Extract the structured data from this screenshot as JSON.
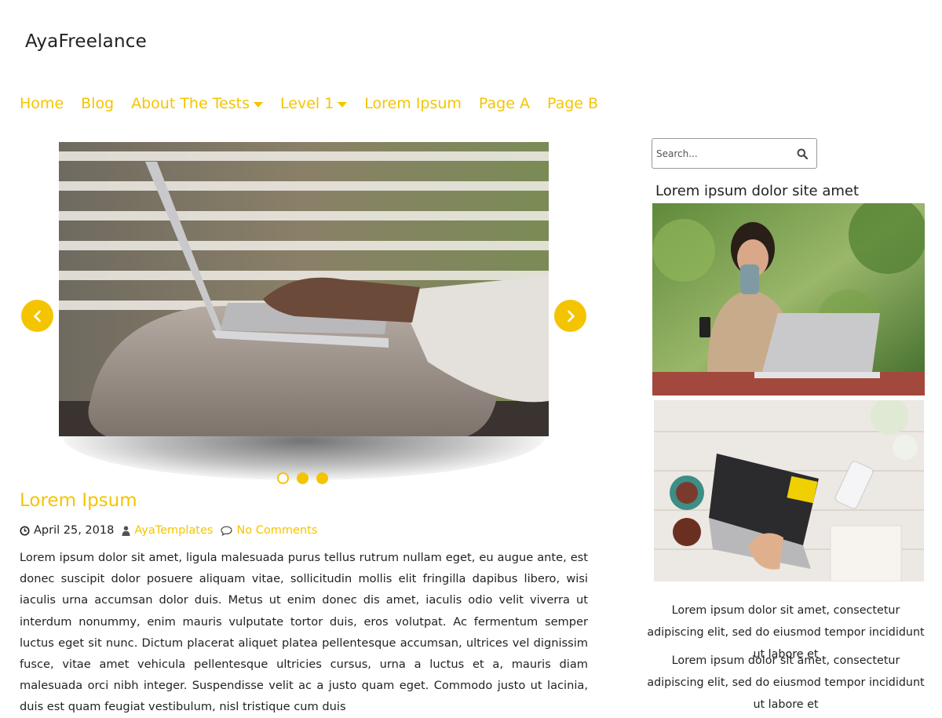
{
  "site": {
    "title": "AyaFreelance"
  },
  "nav": {
    "items": [
      {
        "label": "Home"
      },
      {
        "label": "Blog"
      },
      {
        "label": "About The Tests"
      },
      {
        "label": "Level 1"
      },
      {
        "label": "Lorem Ipsum"
      },
      {
        "label": "Page A"
      },
      {
        "label": "Page B"
      }
    ]
  },
  "slider": {
    "slides_count": 3,
    "active_index": 0
  },
  "post": {
    "title": "Lorem Ipsum",
    "date": "April 25, 2018",
    "author": "AyaTemplates",
    "comments": "No Comments",
    "excerpt": "Lorem ipsum dolor sit amet, ligula malesuada purus tellus rutrum nullam eget, eu augue ante, est donec suscipit dolor posuere aliquam vitae, sollicitudin mollis elit fringilla dapibus libero, wisi iaculis urna accumsan dolor duis. Metus ut enim donec dis amet, iaculis odio velit viverra ut interdum nonummy, enim mauris vulputate tortor duis, eros volutpat. Ac fermentum semper luctus eget sit nunc. Dictum placerat aliquet platea pellentesque accumsan, ultrices vel dignissim fusce, vitae amet vehicula pellentesque ultricies cursus, urna a luctus et a, mauris diam malesuada orci nibh integer. Suspendisse velit ac a justo quam eget. Commodo justo ut lacinia, duis est quam feugiat vestibulum, nisl tristique cum duis"
  },
  "sidebar": {
    "search_placeholder": "Search...",
    "widget_title": "Lorem ipsum dolor site amet",
    "paragraph1": "Lorem ipsum dolor sit amet, consectetur adipiscing elit, sed do eiusmod tempor incididunt ut labore et",
    "paragraph2": "Lorem ipsum dolor sit amet, consectetur adipiscing elit, sed do eiusmod tempor incididunt ut labore et"
  },
  "colors": {
    "accent": "#f5c400",
    "text": "#222222"
  }
}
